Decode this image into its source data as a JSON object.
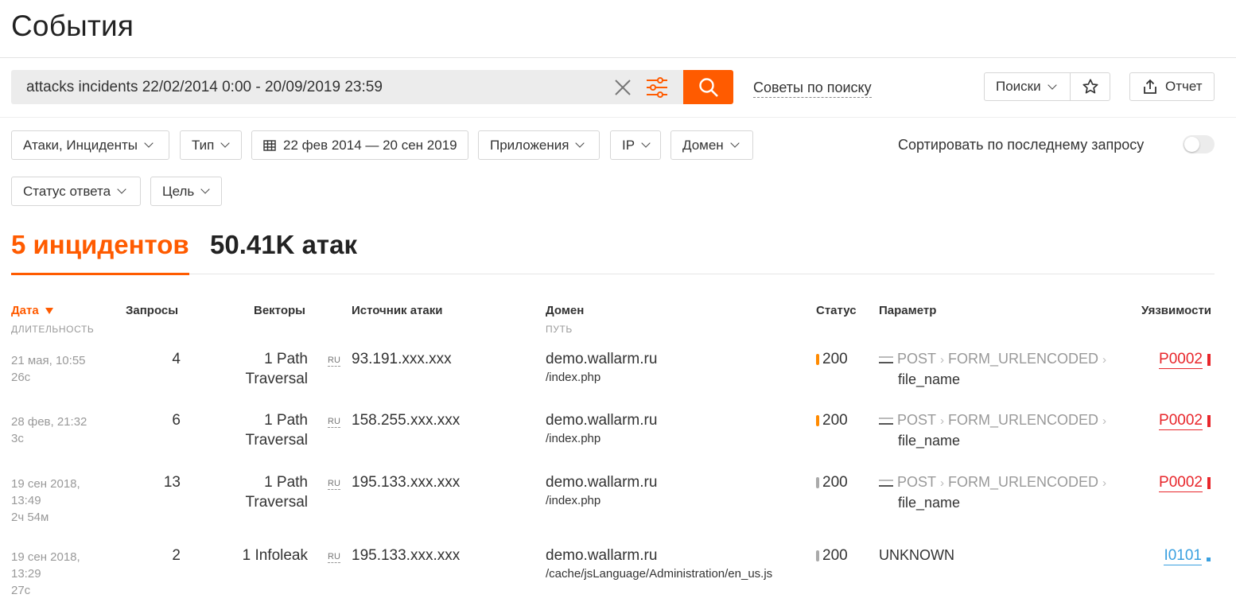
{
  "page": {
    "title": "События"
  },
  "search": {
    "query": "attacks incidents 22/02/2014 0:00 - 20/09/2019 23:59",
    "tips_label": "Советы по поиску"
  },
  "toolbar": {
    "searches_label": "Поиски",
    "report_label": "Отчет"
  },
  "filters": [
    {
      "label": "Атаки, Инциденты"
    },
    {
      "label": "Тип"
    },
    {
      "label": "22 фев 2014 — 20 сен 2019",
      "icon": "calendar-icon"
    },
    {
      "label": "Приложения"
    },
    {
      "label": "IP"
    },
    {
      "label": "Домен"
    },
    {
      "label": "Статус ответа"
    },
    {
      "label": "Цель"
    }
  ],
  "sort_toggle": {
    "label": "Сортировать по последнему запросу",
    "on": false
  },
  "counters": {
    "incidents": "5 инцидентов",
    "attacks": "50.41K атак",
    "active": "incidents"
  },
  "table": {
    "headers": {
      "date": "Дата",
      "date_sub": "ДЛИТЕЛЬНОСТЬ",
      "requests": "Запросы",
      "vectors": "Векторы",
      "source": "Источник атаки",
      "domain": "Домен",
      "domain_sub": "ПУТЬ",
      "status": "Статус",
      "param": "Параметр",
      "vulns": "Уязвимости"
    },
    "rows": [
      {
        "date": "21 мая, 10:55",
        "duration": "26с",
        "requests": "4",
        "vector_line1": "1 Path",
        "vector_line2": "Traversal",
        "country": "RU",
        "ip": "93.191.xxx.xxx",
        "domain": "demo.wallarm.ru",
        "path": "/index.php",
        "status": "200",
        "status_color": "#ff8a00",
        "param_method": "POST",
        "param_type": "FORM_URLENCODED",
        "param_name": "file_name",
        "vuln": "P0002",
        "vuln_color": "#e8262b"
      },
      {
        "date": "28 фев, 21:32",
        "duration": "3с",
        "requests": "6",
        "vector_line1": "1 Path",
        "vector_line2": "Traversal",
        "country": "RU",
        "ip": "158.255.xxx.xxx",
        "domain": "demo.wallarm.ru",
        "path": "/index.php",
        "status": "200",
        "status_color": "#ff8a00",
        "param_method": "POST",
        "param_type": "FORM_URLENCODED",
        "param_name": "file_name",
        "vuln": "P0002",
        "vuln_color": "#e8262b"
      },
      {
        "date": "19 сен 2018, 13:49",
        "duration": "2ч 54м",
        "requests": "13",
        "vector_line1": "1 Path",
        "vector_line2": "Traversal",
        "country": "RU",
        "ip": "195.133.xxx.xxx",
        "domain": "demo.wallarm.ru",
        "path": "/index.php",
        "status": "200",
        "status_color": "#aaaaaa",
        "param_method": "POST",
        "param_type": "FORM_URLENCODED",
        "param_name": "file_name",
        "vuln": "P0002",
        "vuln_color": "#e8262b"
      },
      {
        "date": "19 сен 2018, 13:29",
        "duration": "27с",
        "requests": "2",
        "vector_line1": "1 Infoleak",
        "vector_line2": "",
        "country": "RU",
        "ip": "195.133.xxx.xxx",
        "domain": "demo.wallarm.ru",
        "path": "/cache/jsLanguage/Administration/en_us.js",
        "status": "200",
        "status_color": "#aaaaaa",
        "param_unknown": "UNKNOWN",
        "vuln": "I0101",
        "vuln_color": "#3aa0e0"
      }
    ]
  },
  "colors": {
    "accent": "#ff5b00",
    "text": "#222222",
    "muted": "#999999"
  }
}
